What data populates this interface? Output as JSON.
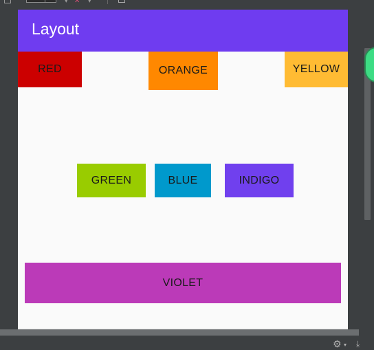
{
  "app": {
    "title": "Layout"
  },
  "buttons": {
    "red": "RED",
    "orange": "ORANGE",
    "yellow": "YELLOW",
    "green": "GREEN",
    "blue": "BLUE",
    "indigo": "INDIGO",
    "violet": "VIOLET"
  },
  "colors": {
    "app_bar": "#6f3cf0",
    "red": "#cc0000",
    "orange": "#ff8800",
    "yellow": "#ffbb33",
    "green": "#99cc00",
    "blue": "#0099cc",
    "indigo": "#7040ee",
    "violet": "#bb3ab8",
    "background": "#fafafa",
    "ide_background": "#3c3f41"
  },
  "icons": {
    "gear": "gear-icon",
    "download": "download-icon",
    "avatar": "android-avatar-icon"
  }
}
